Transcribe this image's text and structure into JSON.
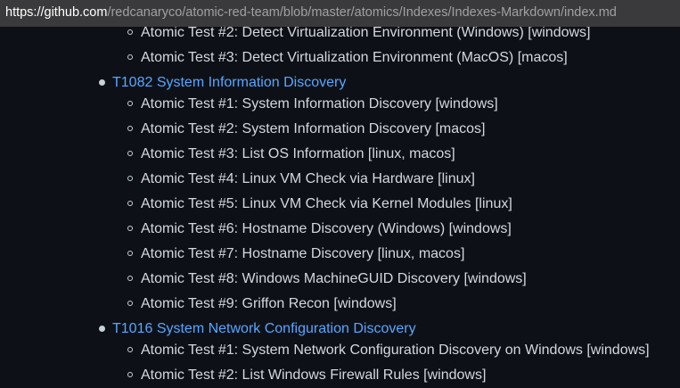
{
  "browser": {
    "url_host": "https://github.com",
    "url_path": "/redcanaryco/atomic-red-team/blob/master/atomics/Indexes/Indexes-Markdown/index.md"
  },
  "document": {
    "partial_top_items": [
      "Atomic Test #2: Detect Virtualization Environment (Windows) [windows]",
      "Atomic Test #3: Detect Virtualization Environment (MacOS) [macos]"
    ],
    "techniques": [
      {
        "title": "T1082 System Information Discovery",
        "tests": [
          "Atomic Test #1: System Information Discovery [windows]",
          "Atomic Test #2: System Information Discovery [macos]",
          "Atomic Test #3: List OS Information [linux, macos]",
          "Atomic Test #4: Linux VM Check via Hardware [linux]",
          "Atomic Test #5: Linux VM Check via Kernel Modules [linux]",
          "Atomic Test #6: Hostname Discovery (Windows) [windows]",
          "Atomic Test #7: Hostname Discovery [linux, macos]",
          "Atomic Test #8: Windows MachineGUID Discovery [windows]",
          "Atomic Test #9: Griffon Recon [windows]"
        ]
      },
      {
        "title": "T1016 System Network Configuration Discovery",
        "tests": [
          "Atomic Test #1: System Network Configuration Discovery on Windows [windows]",
          "Atomic Test #2: List Windows Firewall Rules [windows]"
        ]
      }
    ]
  }
}
